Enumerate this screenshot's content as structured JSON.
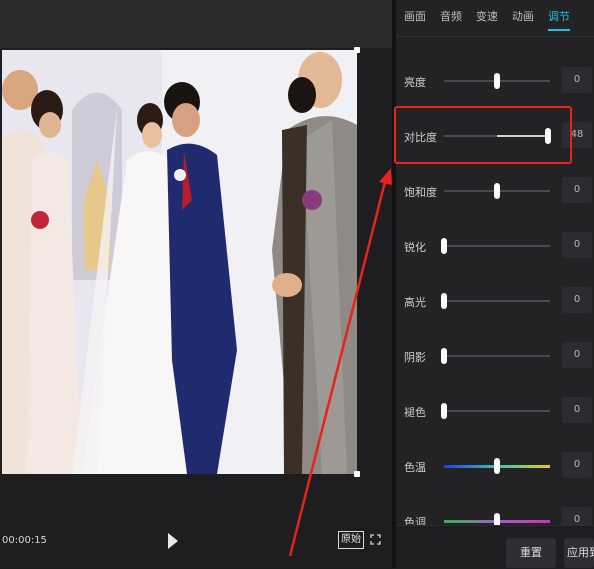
{
  "player": {
    "timecode": "00:00:15",
    "original_label": "原始"
  },
  "tabs": [
    {
      "label": "画面"
    },
    {
      "label": "音频"
    },
    {
      "label": "变速"
    },
    {
      "label": "动画"
    },
    {
      "label": "调节"
    }
  ],
  "active_tab": "调节",
  "adjust": {
    "rows": [
      {
        "label": "亮度",
        "value": "0",
        "level_percent": 50
      },
      {
        "label": "对比度",
        "value": "48",
        "level_percent": 98
      },
      {
        "label": "饱和度",
        "value": "0",
        "level_percent": 50
      },
      {
        "label": "锐化",
        "value": "0",
        "level_percent": 0
      },
      {
        "label": "高光",
        "value": "0",
        "level_percent": 0
      },
      {
        "label": "阴影",
        "value": "0",
        "level_percent": 0
      },
      {
        "label": "褪色",
        "value": "0",
        "level_percent": 0
      },
      {
        "label": "色温",
        "value": "0",
        "level_percent": 50
      },
      {
        "label": "色调",
        "value": "0",
        "level_percent": 50
      }
    ]
  },
  "footer": {
    "reset_label": "重置",
    "apply_all_label": "应用到全部"
  },
  "colors": {
    "accent": "#22c0de",
    "highlight_box": "#e8231b",
    "annotation_arrow": "#e8231b"
  },
  "icons": {
    "play": "play-icon",
    "fullscreen": "fullscreen-icon"
  }
}
